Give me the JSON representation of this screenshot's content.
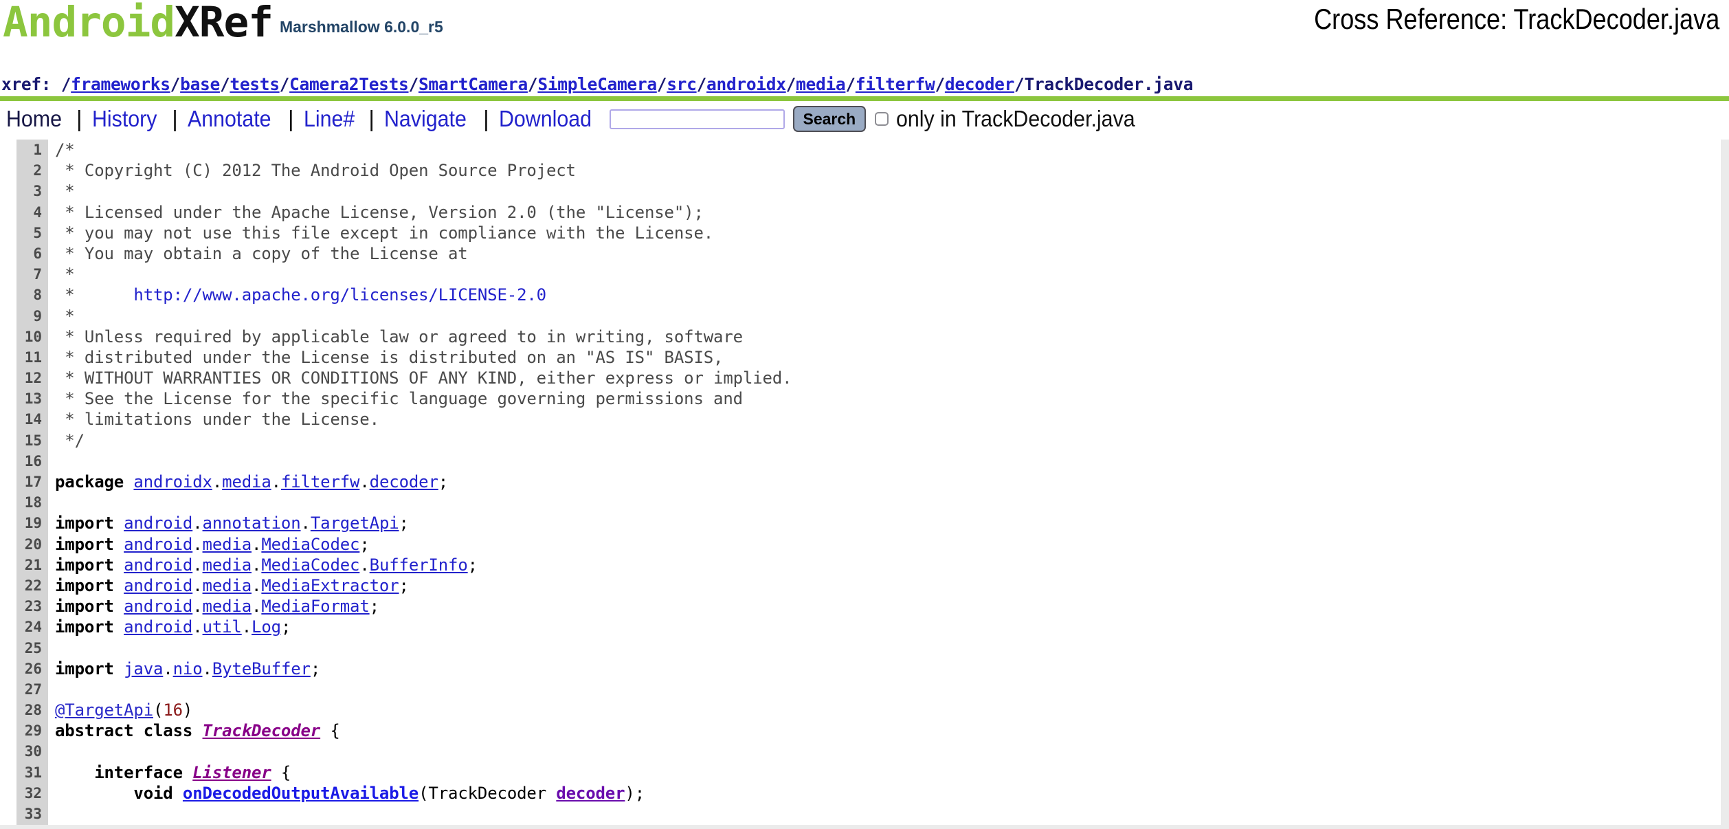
{
  "header": {
    "logo_android": "Android",
    "logo_xref": "XRef",
    "logo_version": "Marshmallow 6.0.0_r5",
    "page_title": "Cross Reference: TrackDecoder.java"
  },
  "xref": {
    "label": "xref: ",
    "segments": [
      "frameworks",
      "base",
      "tests",
      "Camera2Tests",
      "SmartCamera",
      "SimpleCamera",
      "src",
      "androidx",
      "media",
      "filterfw",
      "decoder"
    ],
    "filename": "TrackDecoder.java",
    "separator": "/"
  },
  "nav": {
    "items": [
      {
        "label": "Home",
        "current": true
      },
      {
        "label": "History",
        "current": false
      },
      {
        "label": "Annotate",
        "current": false
      },
      {
        "label": "Line#",
        "current": false
      },
      {
        "label": "Navigate",
        "current": false
      },
      {
        "label": "Download",
        "current": false
      }
    ],
    "separator": "|",
    "search_value": "",
    "search_placeholder": "",
    "search_button_label": "Search",
    "only_in_label": "only in TrackDecoder.java",
    "only_in_checked": false
  },
  "colors": {
    "brand_green": "#8cc63e",
    "logo_black": "#111111",
    "link_blue": "#2222cc",
    "navy": "#191970",
    "gutter_grey": "#d4d4d4",
    "comment_grey": "#4a4a4a",
    "type_purple": "#880088",
    "func_blue": "#1a1ae6",
    "var_purple": "#6a0dad",
    "number_red": "#8b1a1a",
    "button_grey": "#9aabc4",
    "input_border": "#b0a8e8"
  },
  "code": {
    "language": "java",
    "first_line": 1,
    "lines": [
      {
        "n": 1,
        "tokens": [
          {
            "c": "comment",
            "t": "/*"
          }
        ]
      },
      {
        "n": 2,
        "tokens": [
          {
            "c": "comment",
            "t": " * Copyright (C) 2012 The Android Open Source Project"
          }
        ]
      },
      {
        "n": 3,
        "tokens": [
          {
            "c": "comment",
            "t": " *"
          }
        ]
      },
      {
        "n": 4,
        "tokens": [
          {
            "c": "comment",
            "t": " * Licensed under the Apache License, Version 2.0 (the \"License\");"
          }
        ]
      },
      {
        "n": 5,
        "tokens": [
          {
            "c": "comment",
            "t": " * you may not use this file except in compliance with the License."
          }
        ]
      },
      {
        "n": 6,
        "tokens": [
          {
            "c": "comment",
            "t": " * You may obtain a copy of the License at"
          }
        ]
      },
      {
        "n": 7,
        "tokens": [
          {
            "c": "comment",
            "t": " *"
          }
        ]
      },
      {
        "n": 8,
        "tokens": [
          {
            "c": "comment",
            "t": " *      "
          },
          {
            "c": "link",
            "t": "http://www.apache.org/licenses/LICENSE-2.0"
          }
        ]
      },
      {
        "n": 9,
        "tokens": [
          {
            "c": "comment",
            "t": " *"
          }
        ]
      },
      {
        "n": 10,
        "tokens": [
          {
            "c": "comment",
            "t": " * Unless required by applicable law or agreed to in writing, software"
          }
        ]
      },
      {
        "n": 11,
        "tokens": [
          {
            "c": "comment",
            "t": " * distributed under the License is distributed on an \"AS IS\" BASIS,"
          }
        ]
      },
      {
        "n": 12,
        "tokens": [
          {
            "c": "comment",
            "t": " * WITHOUT WARRANTIES OR CONDITIONS OF ANY KIND, either express or implied."
          }
        ]
      },
      {
        "n": 13,
        "tokens": [
          {
            "c": "comment",
            "t": " * See the License for the specific language governing permissions and"
          }
        ]
      },
      {
        "n": 14,
        "tokens": [
          {
            "c": "comment",
            "t": " * limitations under the License."
          }
        ]
      },
      {
        "n": 15,
        "tokens": [
          {
            "c": "comment",
            "t": " */"
          }
        ]
      },
      {
        "n": 16,
        "tokens": []
      },
      {
        "n": 17,
        "tokens": [
          {
            "c": "keyword",
            "t": "package"
          },
          {
            "c": "plain",
            "t": " "
          },
          {
            "c": "ident",
            "t": "androidx"
          },
          {
            "c": "punct",
            "t": "."
          },
          {
            "c": "ident",
            "t": "media"
          },
          {
            "c": "punct",
            "t": "."
          },
          {
            "c": "ident",
            "t": "filterfw"
          },
          {
            "c": "punct",
            "t": "."
          },
          {
            "c": "ident",
            "t": "decoder"
          },
          {
            "c": "punct",
            "t": ";"
          }
        ]
      },
      {
        "n": 18,
        "tokens": []
      },
      {
        "n": 19,
        "tokens": [
          {
            "c": "keyword",
            "t": "import"
          },
          {
            "c": "plain",
            "t": " "
          },
          {
            "c": "ident",
            "t": "android"
          },
          {
            "c": "punct",
            "t": "."
          },
          {
            "c": "ident",
            "t": "annotation"
          },
          {
            "c": "punct",
            "t": "."
          },
          {
            "c": "ident",
            "t": "TargetApi"
          },
          {
            "c": "punct",
            "t": ";"
          }
        ]
      },
      {
        "n": 20,
        "tokens": [
          {
            "c": "keyword",
            "t": "import"
          },
          {
            "c": "plain",
            "t": " "
          },
          {
            "c": "ident",
            "t": "android"
          },
          {
            "c": "punct",
            "t": "."
          },
          {
            "c": "ident",
            "t": "media"
          },
          {
            "c": "punct",
            "t": "."
          },
          {
            "c": "ident",
            "t": "MediaCodec"
          },
          {
            "c": "punct",
            "t": ";"
          }
        ]
      },
      {
        "n": 21,
        "tokens": [
          {
            "c": "keyword",
            "t": "import"
          },
          {
            "c": "plain",
            "t": " "
          },
          {
            "c": "ident",
            "t": "android"
          },
          {
            "c": "punct",
            "t": "."
          },
          {
            "c": "ident",
            "t": "media"
          },
          {
            "c": "punct",
            "t": "."
          },
          {
            "c": "ident",
            "t": "MediaCodec"
          },
          {
            "c": "punct",
            "t": "."
          },
          {
            "c": "ident",
            "t": "BufferInfo"
          },
          {
            "c": "punct",
            "t": ";"
          }
        ]
      },
      {
        "n": 22,
        "tokens": [
          {
            "c": "keyword",
            "t": "import"
          },
          {
            "c": "plain",
            "t": " "
          },
          {
            "c": "ident",
            "t": "android"
          },
          {
            "c": "punct",
            "t": "."
          },
          {
            "c": "ident",
            "t": "media"
          },
          {
            "c": "punct",
            "t": "."
          },
          {
            "c": "ident",
            "t": "MediaExtractor"
          },
          {
            "c": "punct",
            "t": ";"
          }
        ]
      },
      {
        "n": 23,
        "tokens": [
          {
            "c": "keyword",
            "t": "import"
          },
          {
            "c": "plain",
            "t": " "
          },
          {
            "c": "ident",
            "t": "android"
          },
          {
            "c": "punct",
            "t": "."
          },
          {
            "c": "ident",
            "t": "media"
          },
          {
            "c": "punct",
            "t": "."
          },
          {
            "c": "ident",
            "t": "MediaFormat"
          },
          {
            "c": "punct",
            "t": ";"
          }
        ]
      },
      {
        "n": 24,
        "tokens": [
          {
            "c": "keyword",
            "t": "import"
          },
          {
            "c": "plain",
            "t": " "
          },
          {
            "c": "ident",
            "t": "android"
          },
          {
            "c": "punct",
            "t": "."
          },
          {
            "c": "ident",
            "t": "util"
          },
          {
            "c": "punct",
            "t": "."
          },
          {
            "c": "ident",
            "t": "Log"
          },
          {
            "c": "punct",
            "t": ";"
          }
        ]
      },
      {
        "n": 25,
        "tokens": []
      },
      {
        "n": 26,
        "tokens": [
          {
            "c": "keyword",
            "t": "import"
          },
          {
            "c": "plain",
            "t": " "
          },
          {
            "c": "ident",
            "t": "java"
          },
          {
            "c": "punct",
            "t": "."
          },
          {
            "c": "ident",
            "t": "nio"
          },
          {
            "c": "punct",
            "t": "."
          },
          {
            "c": "ident",
            "t": "ByteBuffer"
          },
          {
            "c": "punct",
            "t": ";"
          }
        ]
      },
      {
        "n": 27,
        "tokens": []
      },
      {
        "n": 28,
        "tokens": [
          {
            "c": "anno",
            "t": "@TargetApi"
          },
          {
            "c": "punct",
            "t": "("
          },
          {
            "c": "number",
            "t": "16"
          },
          {
            "c": "punct",
            "t": ")"
          }
        ]
      },
      {
        "n": 29,
        "tokens": [
          {
            "c": "keyword",
            "t": "abstract class"
          },
          {
            "c": "plain",
            "t": " "
          },
          {
            "c": "type",
            "t": "TrackDecoder"
          },
          {
            "c": "plain",
            "t": " {"
          }
        ]
      },
      {
        "n": 30,
        "tokens": []
      },
      {
        "n": 31,
        "tokens": [
          {
            "c": "plain",
            "t": "    "
          },
          {
            "c": "keyword",
            "t": "interface"
          },
          {
            "c": "plain",
            "t": " "
          },
          {
            "c": "type",
            "t": "Listener"
          },
          {
            "c": "plain",
            "t": " {"
          }
        ]
      },
      {
        "n": 32,
        "tokens": [
          {
            "c": "plain",
            "t": "        "
          },
          {
            "c": "keyword",
            "t": "void"
          },
          {
            "c": "plain",
            "t": " "
          },
          {
            "c": "func",
            "t": "onDecodedOutputAvailable"
          },
          {
            "c": "punct",
            "t": "("
          },
          {
            "c": "plain",
            "t": "TrackDecoder "
          },
          {
            "c": "var",
            "t": "decoder"
          },
          {
            "c": "punct",
            "t": ");"
          }
        ]
      },
      {
        "n": 33,
        "tokens": []
      }
    ]
  }
}
